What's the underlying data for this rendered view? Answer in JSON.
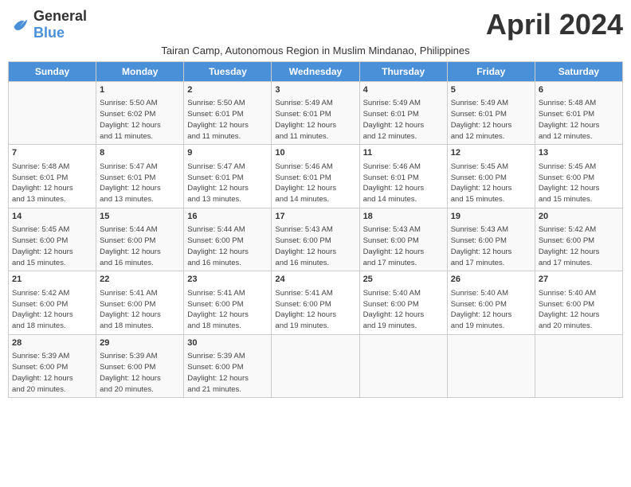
{
  "header": {
    "logo_general": "General",
    "logo_blue": "Blue",
    "month_title": "April 2024",
    "subtitle": "Tairan Camp, Autonomous Region in Muslim Mindanao, Philippines"
  },
  "weekdays": [
    "Sunday",
    "Monday",
    "Tuesday",
    "Wednesday",
    "Thursday",
    "Friday",
    "Saturday"
  ],
  "weeks": [
    [
      {
        "day": "",
        "info": ""
      },
      {
        "day": "1",
        "info": "Sunrise: 5:50 AM\nSunset: 6:02 PM\nDaylight: 12 hours\nand 11 minutes."
      },
      {
        "day": "2",
        "info": "Sunrise: 5:50 AM\nSunset: 6:01 PM\nDaylight: 12 hours\nand 11 minutes."
      },
      {
        "day": "3",
        "info": "Sunrise: 5:49 AM\nSunset: 6:01 PM\nDaylight: 12 hours\nand 11 minutes."
      },
      {
        "day": "4",
        "info": "Sunrise: 5:49 AM\nSunset: 6:01 PM\nDaylight: 12 hours\nand 12 minutes."
      },
      {
        "day": "5",
        "info": "Sunrise: 5:49 AM\nSunset: 6:01 PM\nDaylight: 12 hours\nand 12 minutes."
      },
      {
        "day": "6",
        "info": "Sunrise: 5:48 AM\nSunset: 6:01 PM\nDaylight: 12 hours\nand 12 minutes."
      }
    ],
    [
      {
        "day": "7",
        "info": "Sunrise: 5:48 AM\nSunset: 6:01 PM\nDaylight: 12 hours\nand 13 minutes."
      },
      {
        "day": "8",
        "info": "Sunrise: 5:47 AM\nSunset: 6:01 PM\nDaylight: 12 hours\nand 13 minutes."
      },
      {
        "day": "9",
        "info": "Sunrise: 5:47 AM\nSunset: 6:01 PM\nDaylight: 12 hours\nand 13 minutes."
      },
      {
        "day": "10",
        "info": "Sunrise: 5:46 AM\nSunset: 6:01 PM\nDaylight: 12 hours\nand 14 minutes."
      },
      {
        "day": "11",
        "info": "Sunrise: 5:46 AM\nSunset: 6:01 PM\nDaylight: 12 hours\nand 14 minutes."
      },
      {
        "day": "12",
        "info": "Sunrise: 5:45 AM\nSunset: 6:00 PM\nDaylight: 12 hours\nand 15 minutes."
      },
      {
        "day": "13",
        "info": "Sunrise: 5:45 AM\nSunset: 6:00 PM\nDaylight: 12 hours\nand 15 minutes."
      }
    ],
    [
      {
        "day": "14",
        "info": "Sunrise: 5:45 AM\nSunset: 6:00 PM\nDaylight: 12 hours\nand 15 minutes."
      },
      {
        "day": "15",
        "info": "Sunrise: 5:44 AM\nSunset: 6:00 PM\nDaylight: 12 hours\nand 16 minutes."
      },
      {
        "day": "16",
        "info": "Sunrise: 5:44 AM\nSunset: 6:00 PM\nDaylight: 12 hours\nand 16 minutes."
      },
      {
        "day": "17",
        "info": "Sunrise: 5:43 AM\nSunset: 6:00 PM\nDaylight: 12 hours\nand 16 minutes."
      },
      {
        "day": "18",
        "info": "Sunrise: 5:43 AM\nSunset: 6:00 PM\nDaylight: 12 hours\nand 17 minutes."
      },
      {
        "day": "19",
        "info": "Sunrise: 5:43 AM\nSunset: 6:00 PM\nDaylight: 12 hours\nand 17 minutes."
      },
      {
        "day": "20",
        "info": "Sunrise: 5:42 AM\nSunset: 6:00 PM\nDaylight: 12 hours\nand 17 minutes."
      }
    ],
    [
      {
        "day": "21",
        "info": "Sunrise: 5:42 AM\nSunset: 6:00 PM\nDaylight: 12 hours\nand 18 minutes."
      },
      {
        "day": "22",
        "info": "Sunrise: 5:41 AM\nSunset: 6:00 PM\nDaylight: 12 hours\nand 18 minutes."
      },
      {
        "day": "23",
        "info": "Sunrise: 5:41 AM\nSunset: 6:00 PM\nDaylight: 12 hours\nand 18 minutes."
      },
      {
        "day": "24",
        "info": "Sunrise: 5:41 AM\nSunset: 6:00 PM\nDaylight: 12 hours\nand 19 minutes."
      },
      {
        "day": "25",
        "info": "Sunrise: 5:40 AM\nSunset: 6:00 PM\nDaylight: 12 hours\nand 19 minutes."
      },
      {
        "day": "26",
        "info": "Sunrise: 5:40 AM\nSunset: 6:00 PM\nDaylight: 12 hours\nand 19 minutes."
      },
      {
        "day": "27",
        "info": "Sunrise: 5:40 AM\nSunset: 6:00 PM\nDaylight: 12 hours\nand 20 minutes."
      }
    ],
    [
      {
        "day": "28",
        "info": "Sunrise: 5:39 AM\nSunset: 6:00 PM\nDaylight: 12 hours\nand 20 minutes."
      },
      {
        "day": "29",
        "info": "Sunrise: 5:39 AM\nSunset: 6:00 PM\nDaylight: 12 hours\nand 20 minutes."
      },
      {
        "day": "30",
        "info": "Sunrise: 5:39 AM\nSunset: 6:00 PM\nDaylight: 12 hours\nand 21 minutes."
      },
      {
        "day": "",
        "info": ""
      },
      {
        "day": "",
        "info": ""
      },
      {
        "day": "",
        "info": ""
      },
      {
        "day": "",
        "info": ""
      }
    ]
  ]
}
